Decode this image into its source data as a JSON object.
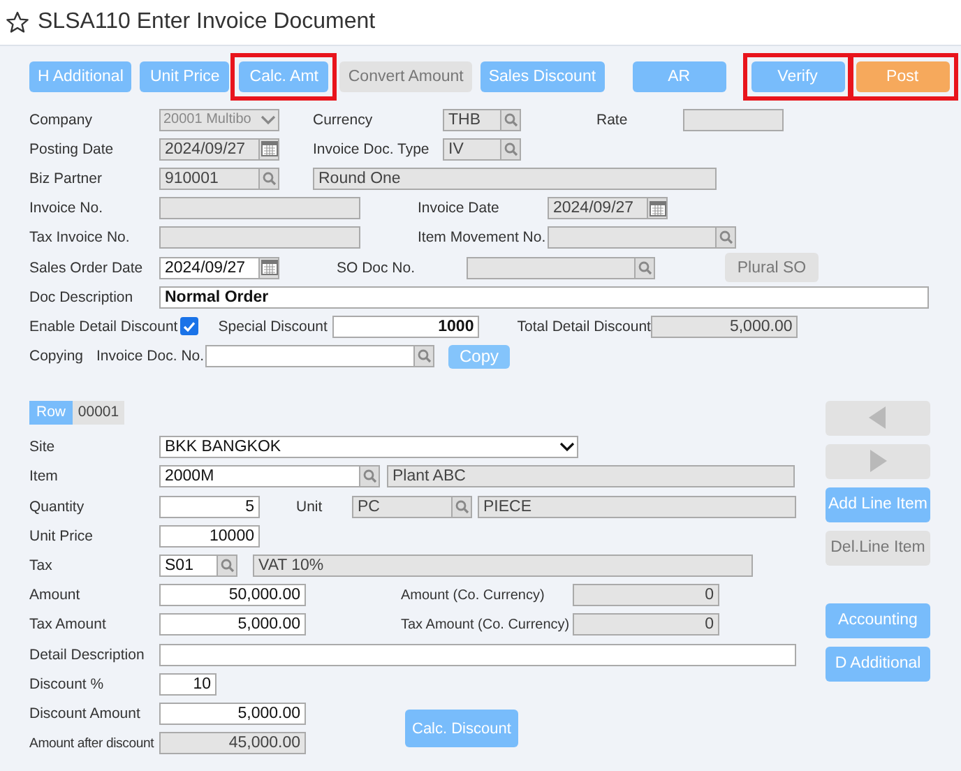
{
  "title": "SLSA110 Enter Invoice Document",
  "toolbar": [
    {
      "label": "H Additional",
      "kind": "primary",
      "highlighted": false
    },
    {
      "label": "Unit Price",
      "kind": "primary",
      "highlighted": false
    },
    {
      "label": "Calc. Amt",
      "kind": "primary",
      "highlighted": true
    },
    {
      "label": "Convert Amount",
      "kind": "disabled",
      "highlighted": false
    },
    {
      "label": "Sales Discount",
      "kind": "primary",
      "highlighted": false
    },
    {
      "label": "AR",
      "kind": "primary",
      "highlighted": false
    },
    {
      "label": "Verify",
      "kind": "primary",
      "highlighted": true
    },
    {
      "label": "Post",
      "kind": "accent",
      "highlighted": true
    }
  ],
  "header": {
    "company": {
      "label": "Company",
      "value": "20001 Multibo",
      "readonly": true
    },
    "currency": {
      "label": "Currency",
      "value": "THB",
      "readonly": true
    },
    "rate": {
      "label": "Rate",
      "readonly": true
    },
    "posting_date": {
      "label": "Posting Date",
      "value": "2024/09/27",
      "readonly": true
    },
    "invoice_doc_type": {
      "label": "Invoice Doc. Type",
      "value": "IV",
      "readonly": true
    },
    "biz_partner": {
      "label": "Biz Partner",
      "value": "910001",
      "readonly": true
    },
    "biz_partner_name": {
      "value": "Round One",
      "readonly": true
    },
    "invoice_no": {
      "label": "Invoice No.",
      "readonly": true
    },
    "invoice_date": {
      "label": "Invoice Date",
      "value": "2024/09/27",
      "readonly": true
    },
    "tax_invoice_no": {
      "label": "Tax Invoice No.",
      "readonly": true
    },
    "item_movement_no": {
      "label": "Item Movement No.",
      "readonly": true
    },
    "sales_order_date": {
      "label": "Sales Order Date",
      "value": "2024/09/27",
      "readonly": false
    },
    "so_doc_no": {
      "label": "SO Doc No.",
      "readonly": true
    },
    "plural_so": {
      "label": "Plural SO",
      "kind": "disabled"
    },
    "doc_description": {
      "label": "Doc Description",
      "value": "Normal Order",
      "readonly": false
    },
    "enable_detail_discount": {
      "label": "Enable Detail Discount",
      "checked": true
    },
    "special_discount": {
      "label": "Special Discount",
      "value": "1000",
      "readonly": false
    },
    "total_detail_discount": {
      "label": "Total Detail Discount",
      "value": "5,000.00",
      "readonly": true
    },
    "copying": {
      "label": "Copying"
    },
    "copy_invoice_doc_no": {
      "label": "Invoice Doc. No.",
      "readonly": false
    },
    "copy": {
      "label": "Copy",
      "kind": "light"
    }
  },
  "line": {
    "row": {
      "label": "Row",
      "value": "00001"
    },
    "site": {
      "label": "Site",
      "value": "BKK BANGKOK",
      "readonly": false
    },
    "item": {
      "label": "Item",
      "value": "2000M",
      "readonly": false
    },
    "item_name": {
      "value": "Plant ABC",
      "readonly": true
    },
    "quantity": {
      "label": "Quantity",
      "value": "5",
      "readonly": false
    },
    "unit": {
      "label": "Unit",
      "value": "PC",
      "readonly": true
    },
    "unit_name": {
      "value": "PIECE",
      "readonly": true
    },
    "unit_price": {
      "label": "Unit Price",
      "value": "10000",
      "readonly": false
    },
    "tax": {
      "label": "Tax",
      "value": "S01",
      "readonly": false
    },
    "tax_name": {
      "value": "VAT 10%",
      "readonly": true
    },
    "amount": {
      "label": "Amount",
      "value": "50,000.00",
      "readonly": false
    },
    "amount_co": {
      "label": "Amount (Co. Currency)",
      "value": "0",
      "readonly": true
    },
    "tax_amount": {
      "label": "Tax Amount",
      "value": "5,000.00",
      "readonly": false
    },
    "tax_amount_co": {
      "label": "Tax Amount (Co. Currency)",
      "value": "0",
      "readonly": true
    },
    "detail_description": {
      "label": "Detail Description",
      "readonly": false
    },
    "discount_pct": {
      "label": "Discount %",
      "value": "10",
      "readonly": false
    },
    "discount_amount": {
      "label": "Discount Amount",
      "value": "5,000.00",
      "readonly": false
    },
    "amount_after_discount": {
      "label": "Amount after discount",
      "value": "45,000.00",
      "readonly": true
    },
    "calc_discount": {
      "label": "Calc. Discount",
      "kind": "primary"
    }
  },
  "side_buttons": [
    {
      "kind": "disabled"
    },
    {
      "kind": "disabled"
    },
    {
      "kind": "primary",
      "label": "Add Line Item"
    },
    {
      "kind": "disabled",
      "label": "Del.Line Item"
    },
    {
      "kind": "primary",
      "label": "Accounting"
    },
    {
      "kind": "primary",
      "label": "D Additional"
    }
  ]
}
